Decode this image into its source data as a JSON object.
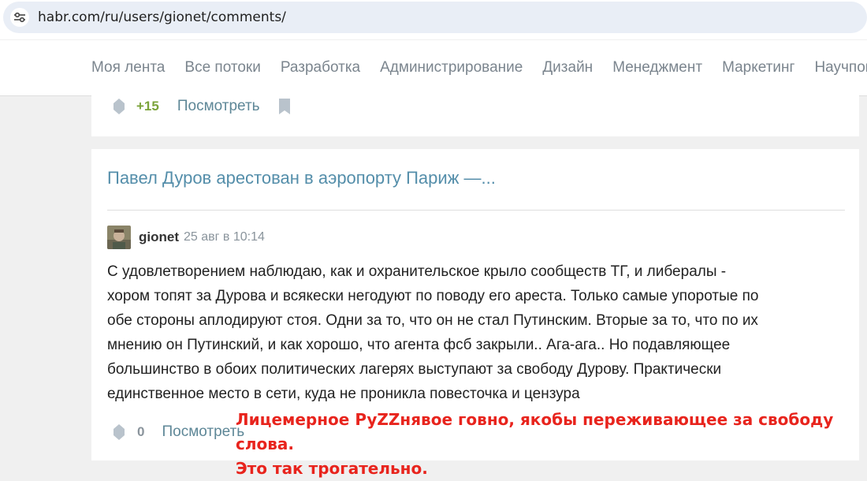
{
  "address_bar": {
    "url": "habr.com/ru/users/gionet/comments/"
  },
  "nav": {
    "items": [
      "Моя лента",
      "Все потоки",
      "Разработка",
      "Администрирование",
      "Дизайн",
      "Менеджмент",
      "Маркетинг",
      "Научпоп"
    ]
  },
  "prev_card": {
    "score": "+15",
    "view_label": "Посмотреть"
  },
  "comment_card": {
    "post_title": "Павел Дуров арестован в аэропорту Париж —...",
    "author": "gionet",
    "timestamp": "25 авг в 10:14",
    "lines": [
      "С удовлетворением наблюдаю, как и охранительское крыло сообществ ТГ, и либералы -",
      "хором топят за Дурова и всякески негодуют по поводу его ареста. Только самые упоротые по",
      "обе стороны аплодируют стоя. Одни за то, что он не стал Путинским. Вторые за то, что по их",
      "мнению он Путинский, и как хорошо, что агента фсб закрыли.. Ага-ага.. Но подавляющее",
      "большинство в обоих политических лагерях выступают за свободу Дурову. Практически",
      "единственное место в сети, куда не проникла повесточка и цензура"
    ],
    "score": "0",
    "view_label": "Посмотреть"
  },
  "overlay_annotation": {
    "lines": [
      "Лицемерное PyZZнявое говно, якобы переживающее за свободу слова.",
      "Это так трогательно."
    ],
    "color": "#e8241d"
  },
  "colors": {
    "accent_link": "#548eaa",
    "positive_score": "#7ba33a",
    "muted": "#8a949c"
  }
}
